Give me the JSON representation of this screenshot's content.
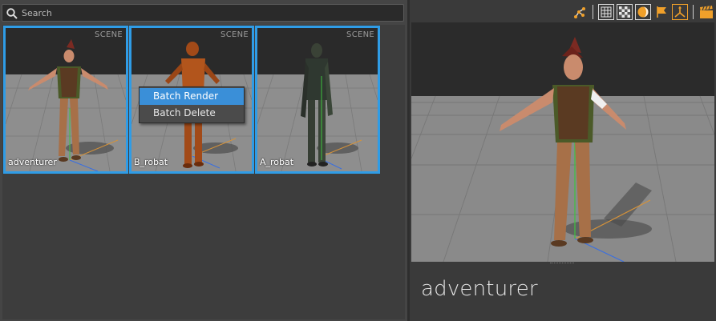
{
  "search": {
    "placeholder": "Search"
  },
  "cards": [
    {
      "name": "adventurer",
      "tag": "SCENE"
    },
    {
      "name": "B_robat",
      "tag": "SCENE"
    },
    {
      "name": "A_robat",
      "tag": "SCENE"
    }
  ],
  "context_menu": {
    "items": [
      "Batch Render",
      "Batch Delete"
    ],
    "highlighted": "Batch Render"
  },
  "toolbar": {
    "icons": [
      "skeleton-icon",
      "grid-icon",
      "checker-texture-icon",
      "sphere-light-icon",
      "flag-icon",
      "axis-gizmo-icon",
      "clapperboard-icon"
    ],
    "active": [
      "axis-gizmo-icon"
    ]
  },
  "preview": {
    "title": "adventurer"
  },
  "colors": {
    "selection": "#2f9ce6",
    "accent": "#f0a02a",
    "menu_highlight": "#3a8fd8"
  }
}
